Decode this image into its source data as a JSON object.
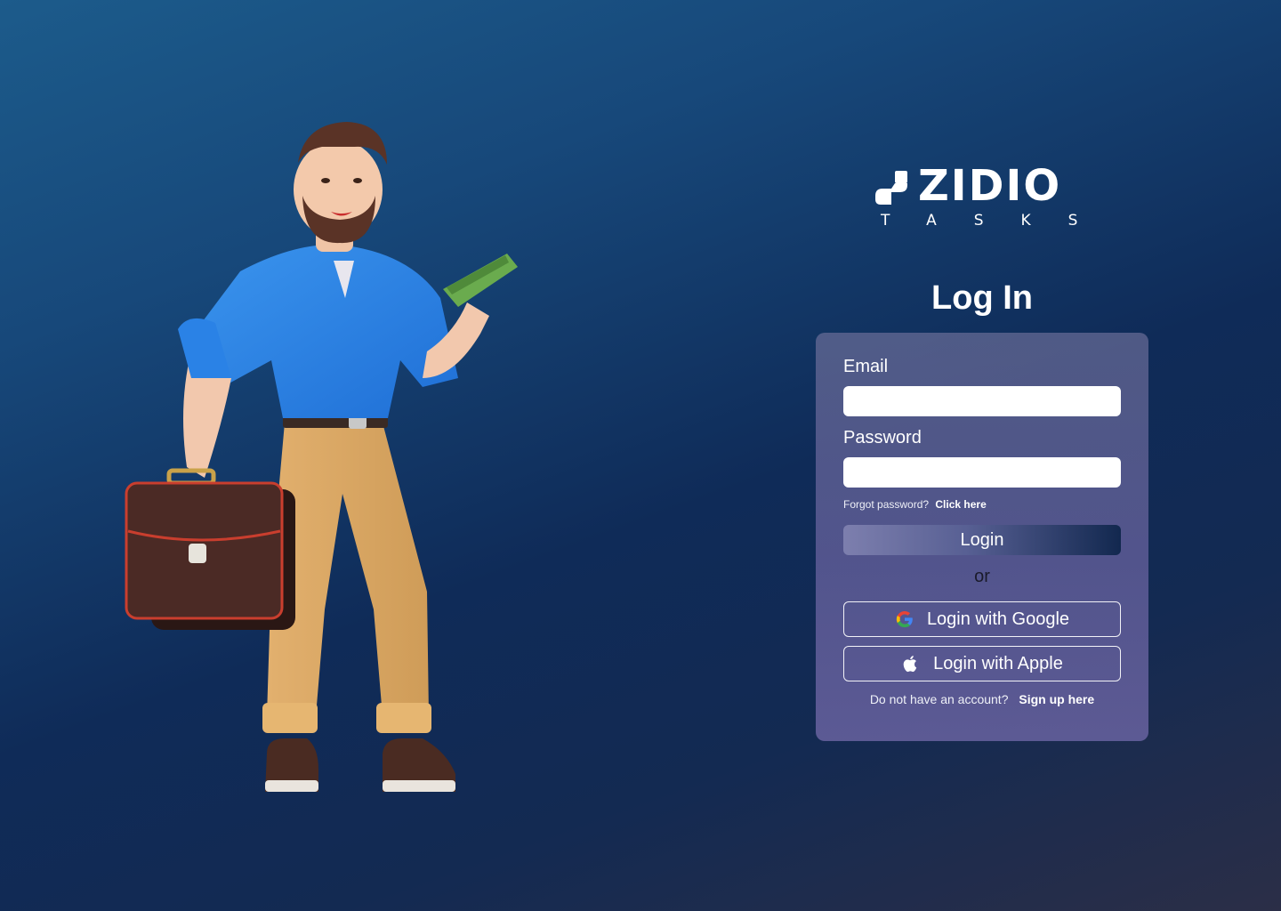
{
  "brand": {
    "name": "ZIDIO",
    "subtitle": "TASKS"
  },
  "page": {
    "title": "Log In"
  },
  "form": {
    "email_label": "Email",
    "email_value": "",
    "password_label": "Password",
    "password_value": "",
    "forgot_text": "Forgot password?",
    "forgot_link": "Click here",
    "login_label": "Login",
    "or_text": "or",
    "google_label": "Login with Google",
    "apple_label": "Login with Apple",
    "signup_text": "Do not have an account?",
    "signup_link": "Sign up here"
  },
  "icons": {
    "google": "google-icon",
    "apple": "apple-icon",
    "brand_mark": "zidio-logo-mark"
  },
  "colors": {
    "background_start": "#1c5b8b",
    "background_end": "#2b2e47",
    "card": "#6a66a0",
    "primary_button_end": "#12284f"
  }
}
